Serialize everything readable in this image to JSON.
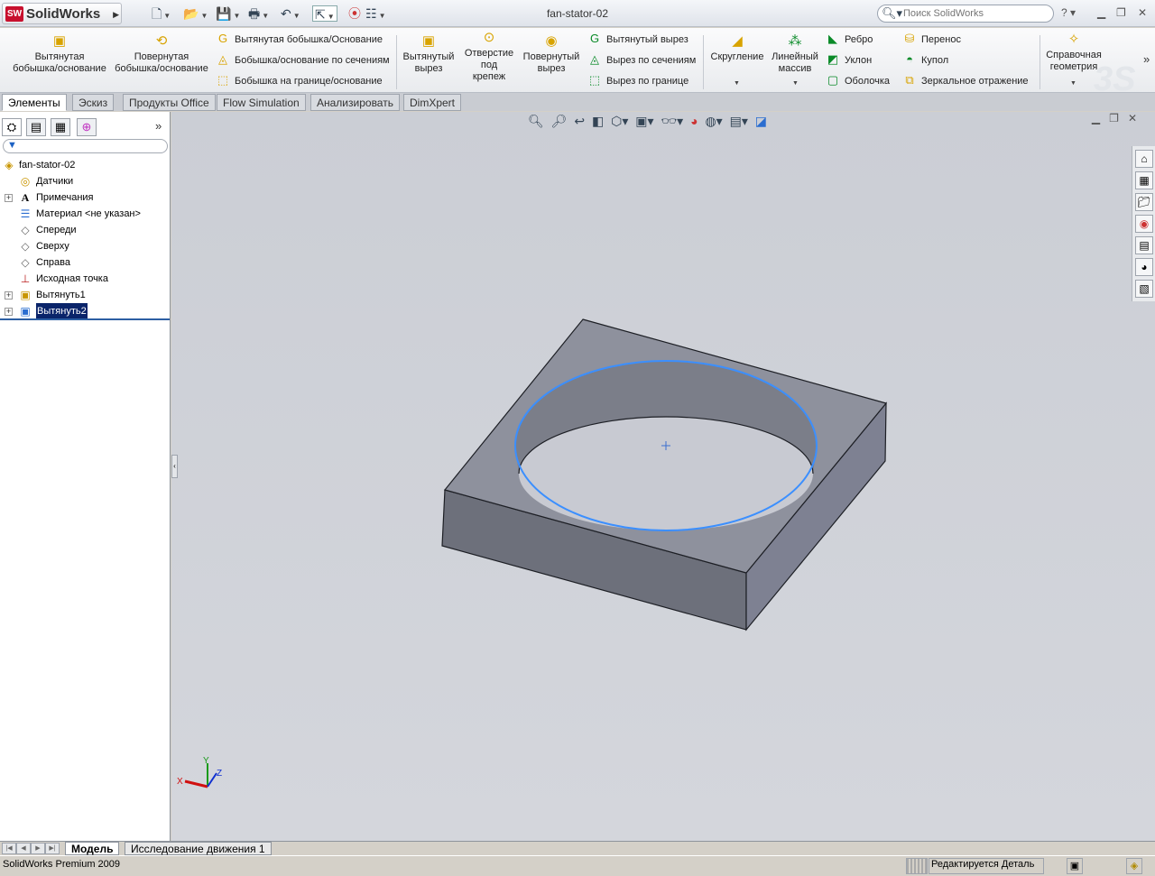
{
  "app": {
    "logo": "SolidWorks",
    "doc_title": "fan-stator-02"
  },
  "search": {
    "placeholder": "Поиск SolidWorks"
  },
  "commands": {
    "extruded_boss": "Вытянутая\nбобышка/основание",
    "revolved_boss": "Повернутая\nбобышка/основание",
    "swept_boss": "Вытянутая бобышка/Основание",
    "lofted_boss": "Бобышка/основание по сечениям",
    "boundary_boss": "Бобышка на границе/основание",
    "extruded_cut": "Вытянутый\nвырез",
    "hole_wizard": "Отверстие\nпод\nкрепеж",
    "revolved_cut": "Повернутый\nвырез",
    "swept_cut": "Вытянутый вырез",
    "lofted_cut": "Вырез по сечениям",
    "boundary_cut": "Вырез по границе",
    "fillet": "Скругление",
    "linear_pattern": "Линейный\nмассив",
    "rib": "Ребро",
    "draft": "Уклон",
    "shell": "Оболочка",
    "wrap": "Перенос",
    "dome": "Купол",
    "mirror": "Зеркальное отражение",
    "ref_geometry": "Справочная\nгеометрия"
  },
  "tabs": [
    "Элементы",
    "Эскиз",
    "Продукты Office",
    "Flow Simulation",
    "Анализировать",
    "DimXpert"
  ],
  "tree": [
    {
      "label": "fan-stator-02",
      "icon": "part-icon"
    },
    {
      "label": "Датчики",
      "icon": "sensor-icon"
    },
    {
      "label": "Примечания",
      "icon": "annotation-icon"
    },
    {
      "label": "Материал <не указан>",
      "icon": "material-icon"
    },
    {
      "label": "Спереди",
      "icon": "plane-icon"
    },
    {
      "label": "Сверху",
      "icon": "plane-icon"
    },
    {
      "label": "Справа",
      "icon": "plane-icon"
    },
    {
      "label": "Исходная точка",
      "icon": "origin-icon"
    },
    {
      "label": "Вытянуть1",
      "icon": "extrude-icon"
    },
    {
      "label": "Вытянуть2",
      "icon": "cut-extrude-icon"
    }
  ],
  "bottom_tabs": [
    "Модель",
    "Исследование движения 1"
  ],
  "status": {
    "left": "SolidWorks Premium 2009",
    "right": "Редактируется Деталь"
  },
  "triad": {
    "x": "X",
    "y": "Y",
    "z": "Z"
  },
  "colors": {
    "selection": "#3b8fff",
    "face_top": "#8f929e",
    "face_front": "#6e717d",
    "face_right": "#82859a"
  }
}
